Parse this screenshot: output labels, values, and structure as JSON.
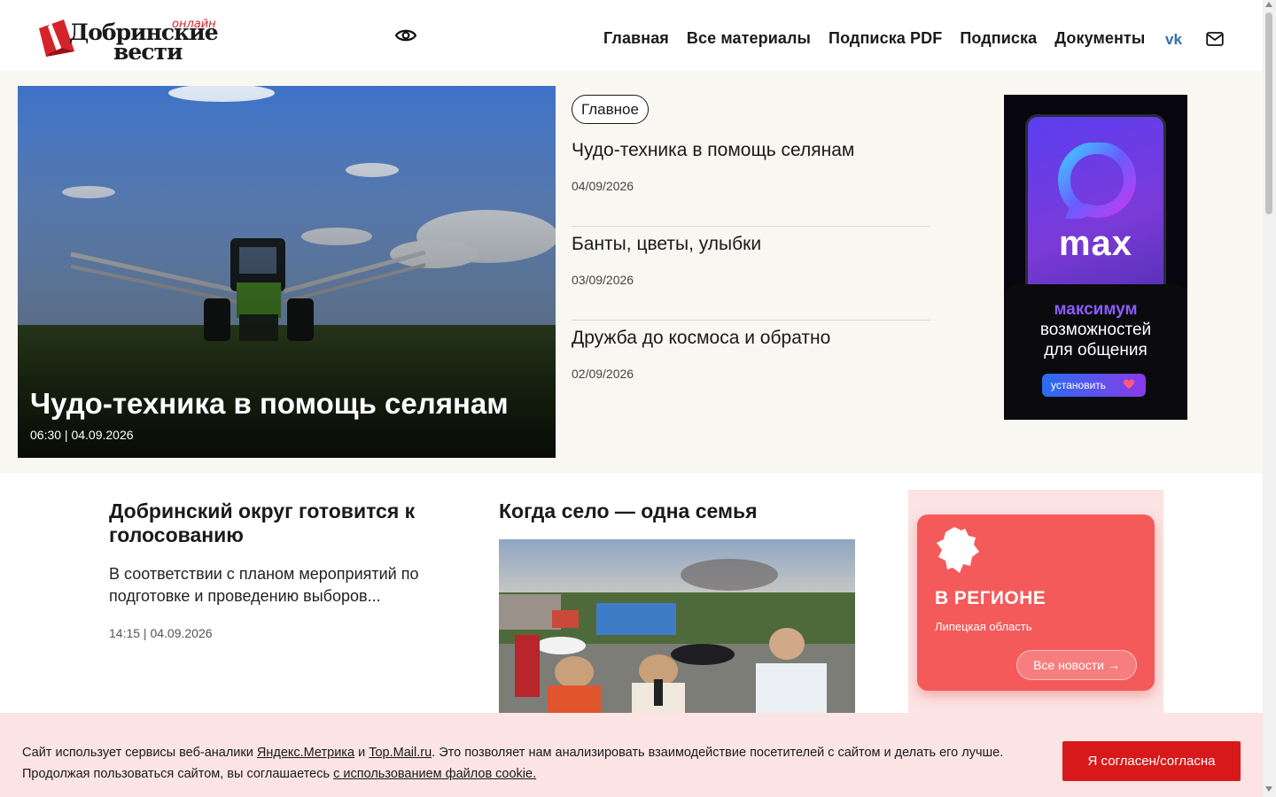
{
  "header": {
    "logo_online": "онлайн",
    "logo_line1": "Добринские",
    "logo_line2": "вести",
    "accessibility_icon": "eye-icon",
    "nav": [
      {
        "label": "Главная"
      },
      {
        "label": "Все материалы"
      },
      {
        "label": "Подписка PDF"
      },
      {
        "label": "Подписка"
      },
      {
        "label": "Документы"
      }
    ],
    "social_icon": "vk-icon",
    "mail_icon": "mail-icon"
  },
  "hero": {
    "title": "Чудо-техника в помощь селянам",
    "meta": "06:30 | 04.09.2026"
  },
  "main_news": {
    "tag": "Главное",
    "items": [
      {
        "title": "Чудо-техника в помощь селянам",
        "date": "04/09/2026"
      },
      {
        "title": "Банты, цветы, улыбки",
        "date": "03/09/2026"
      },
      {
        "title": "Дружба до космоса и обратно",
        "date": "02/09/2026"
      }
    ]
  },
  "ad": {
    "brand": "max",
    "line1": "максимум",
    "line2": "возможностей",
    "line3": "для общения",
    "button": "установить"
  },
  "card1": {
    "title": "Добринский округ готовится к голосованию",
    "text": "В соответствии с планом мероприятий по подготовке и проведению выборов...",
    "meta": "14:15 | 04.09.2026"
  },
  "card2": {
    "title": "Когда село — одна семья"
  },
  "region": {
    "title": "В РЕГИОНЕ",
    "subtitle": "Липецкая область",
    "button": "Все новости →"
  },
  "cookie": {
    "text_before": "Сайт использует сервисы веб-аналики ",
    "link1": "Яндекс.Метрика",
    "text_and": " и ",
    "link2": "Top.Mail.ru",
    "text_after": ". Это позволяет нам анализировать взаимодействие посетителей с сайтом и делать его лучше.",
    "text_line2": "Продолжая пользоваться сайтом, вы соглашаетесь ",
    "link3": "с использованием файлов cookie.",
    "button": "Я согласен/согласна"
  },
  "colors": {
    "accent": "#d8191b",
    "region_card": "#f55a5a",
    "band": "#f9f7f2",
    "cookie_bg": "#fbe4e3"
  }
}
